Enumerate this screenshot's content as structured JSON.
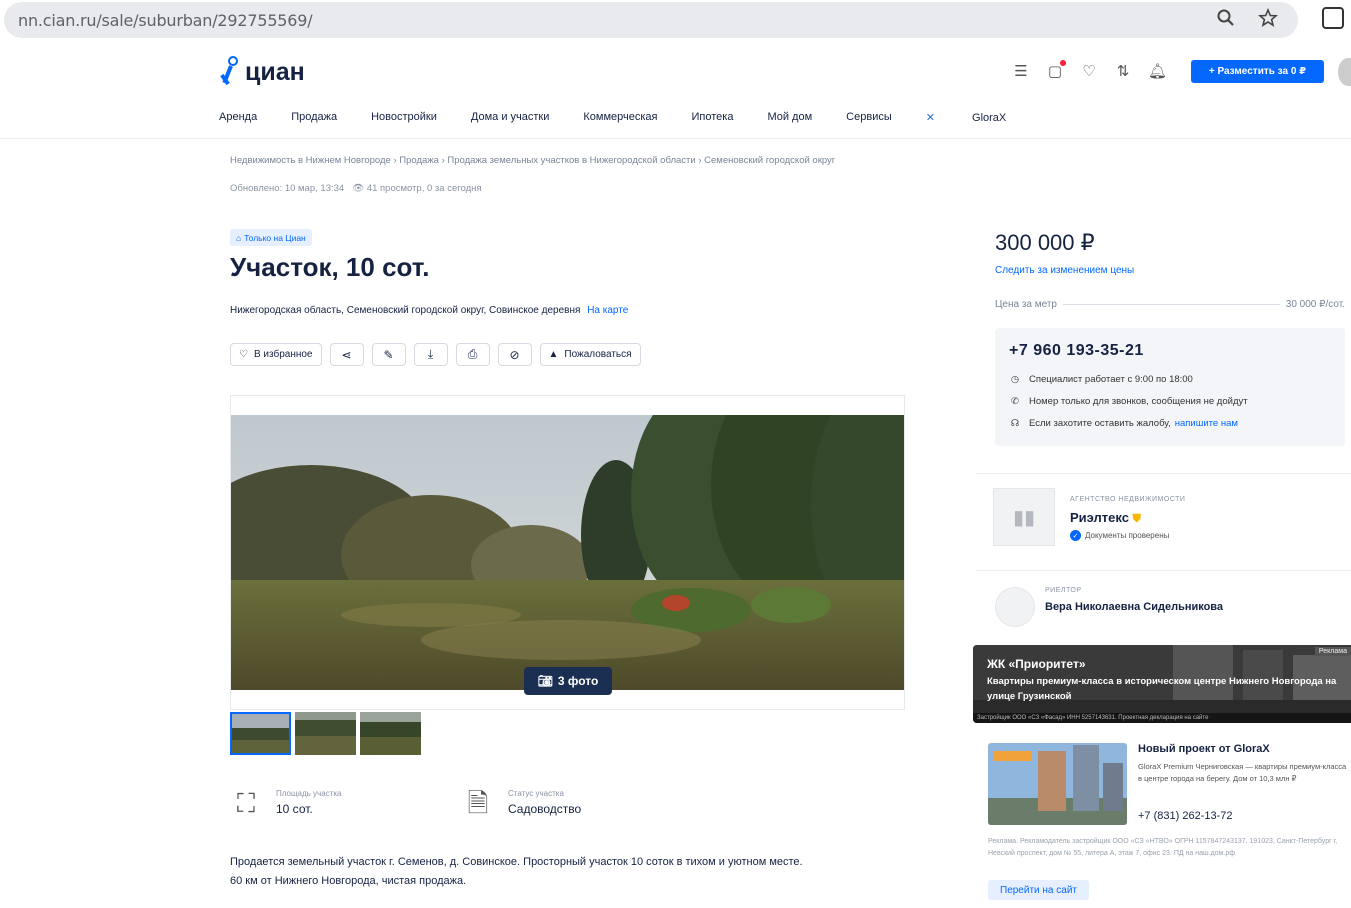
{
  "browser": {
    "url": "nn.cian.ru/sale/suburban/292755569/",
    "zoom_icon": "magnifier-icon",
    "star_icon": "star-icon",
    "extension_icon": "extensions-icon"
  },
  "header": {
    "logo_text": "циан",
    "post_button": "+ Разместить за 0 ₽",
    "icons": [
      "menu-icon",
      "messages-icon",
      "favorites-heart-icon",
      "compare-icon",
      "notifications-bell-icon"
    ]
  },
  "nav": {
    "items": [
      "Аренда",
      "Продажа",
      "Новостройки",
      "Дома и участки",
      "Коммерческая",
      "Ипотека",
      "Мой дом",
      "Сервисы",
      "GloraX"
    ]
  },
  "breadcrumb": {
    "items": [
      "Недвижимость в Нижнем Новгороде",
      "Продажа",
      "Продажа земельных участков в Нижегородской области",
      "Семеновский городской округ"
    ],
    "separator": "›"
  },
  "meta": {
    "updated": "Обновлено: 10 мар, 13:34",
    "views": "41 просмотр, 0 за сегодня"
  },
  "listing": {
    "badge": "Только на Циан",
    "title": "Участок, 10 сот.",
    "address": "Нижегородская область, Семеновский городской округ, Совинское деревня",
    "map_link": "На карте",
    "actions": {
      "favorite": "В избранное",
      "report": "Пожаловаться"
    },
    "photo_button": "3 фото",
    "features": [
      {
        "label": "Площадь участка",
        "value": "10 сот."
      },
      {
        "label": "Статус участка",
        "value": "Садоводство"
      }
    ],
    "description": [
      "Продается земельный участок г. Семенов, д. Совинское. Просторный участок 10 соток в тихом и уютном месте.",
      "60 км от Нижнего Новгорода, чистая продажа."
    ]
  },
  "sidebar": {
    "price": "300 000 ₽",
    "follow_price": "Следить за изменением цены",
    "price_per_meter_label": "Цена за метр",
    "price_per_meter_value": "30 000 ₽/сот.",
    "phone": "+7 960 193-35-21",
    "info": {
      "hours": "Специалист работает с 9:00 по 18:00",
      "calls_only": "Номер только для звонков, сообщения не дойдут",
      "complaint": "Если захотите оставить жалобу,",
      "complaint_link": "напишите нам"
    },
    "agency": {
      "kind": "АГЕНТСТВО НЕДВИЖИМОСТИ",
      "name": "Риэлтекс",
      "verified": "Документы проверены"
    },
    "realtor": {
      "kind": "РИЕЛТОР",
      "name": "Вера Николаевна Сидельникова"
    },
    "ad1": {
      "tag": "Реклама",
      "title": "ЖК «Приоритет»",
      "subtitle": "Квартиры премиум-класса в историческом центре Нижнего Новгорода на улице Грузинской",
      "footer": "Застройщик ООО «СЗ «Фасад» ИНН 5257143631. Проектная декларация на сайте"
    },
    "ad2": {
      "title": "Новый проект от GloraX",
      "text": "GloraX Premium Черниговская — квартиры премиум-класса в центре города на берегу. Дом от 10,3 млн ₽",
      "phone": "+7 (831) 262-13-72",
      "legal": "Реклама. Рекламодатель застройщик ООО «СЗ «НТВО» ОГРН 1157847243137, 191023, Санкт-Петербург г, Невский проспект, дом № 55, литера А, этаж 7, офис 23. ПД на наш.дом.рф",
      "button": "Перейти на сайт"
    }
  }
}
